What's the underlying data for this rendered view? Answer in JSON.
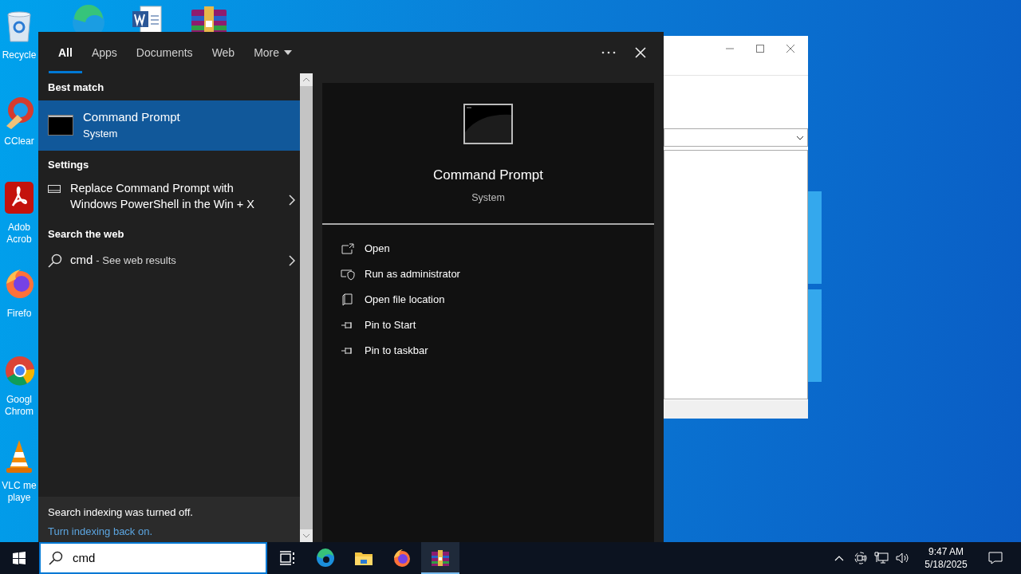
{
  "desktop_icons": [
    {
      "kind": "recycle",
      "lines": [
        "Recycle"
      ]
    },
    {
      "kind": "ccleaner",
      "lines": [
        "CClear"
      ]
    },
    {
      "kind": "acrobat",
      "lines": [
        "Adob",
        "Acrob"
      ]
    },
    {
      "kind": "firefox",
      "lines": [
        "Firefo"
      ]
    },
    {
      "kind": "chrome",
      "lines": [
        "Googl",
        "Chrom"
      ]
    },
    {
      "kind": "vlc",
      "lines": [
        "VLC me",
        "playe"
      ]
    }
  ],
  "search_panel": {
    "tabs": [
      {
        "label": "All",
        "selected": true,
        "kind": "tab"
      },
      {
        "label": "Apps",
        "selected": false,
        "kind": "tab"
      },
      {
        "label": "Documents",
        "selected": false,
        "kind": "tab"
      },
      {
        "label": "Web",
        "selected": false,
        "kind": "tab"
      },
      {
        "label": "More",
        "selected": false,
        "kind": "dropdown"
      }
    ],
    "sections": [
      {
        "heading": "Best match",
        "items": [
          {
            "kind": "app",
            "title": "Command Prompt",
            "subtitle": "System",
            "selected": true
          }
        ]
      },
      {
        "heading": "Settings",
        "items": [
          {
            "kind": "setting",
            "title": "Replace Command Prompt with Windows PowerShell in the Win + X",
            "selected": false
          }
        ]
      },
      {
        "heading": "Search the web",
        "items": [
          {
            "kind": "web",
            "query": "cmd",
            "suffix": "- See web results",
            "selected": false
          }
        ]
      }
    ],
    "notice": {
      "text": "Search indexing was turned off.",
      "link": "Turn indexing back on."
    },
    "preview": {
      "title": "Command Prompt",
      "subtitle": "System",
      "actions": [
        {
          "kind": "open",
          "label": "Open"
        },
        {
          "kind": "admin",
          "label": "Run as administrator"
        },
        {
          "kind": "location",
          "label": "Open file location"
        },
        {
          "kind": "pin",
          "label": "Pin to Start"
        },
        {
          "kind": "pin",
          "label": "Pin to taskbar"
        }
      ]
    }
  },
  "taskbar": {
    "search_box": {
      "value": "cmd"
    },
    "apps": [
      {
        "kind": "taskview",
        "active": false
      },
      {
        "kind": "edge",
        "active": false
      },
      {
        "kind": "explorer",
        "active": false
      },
      {
        "kind": "firefox",
        "active": false
      },
      {
        "kind": "winrar",
        "active": true
      }
    ],
    "clock": {
      "time": "9:47 AM",
      "date": "5/18/2025"
    }
  }
}
